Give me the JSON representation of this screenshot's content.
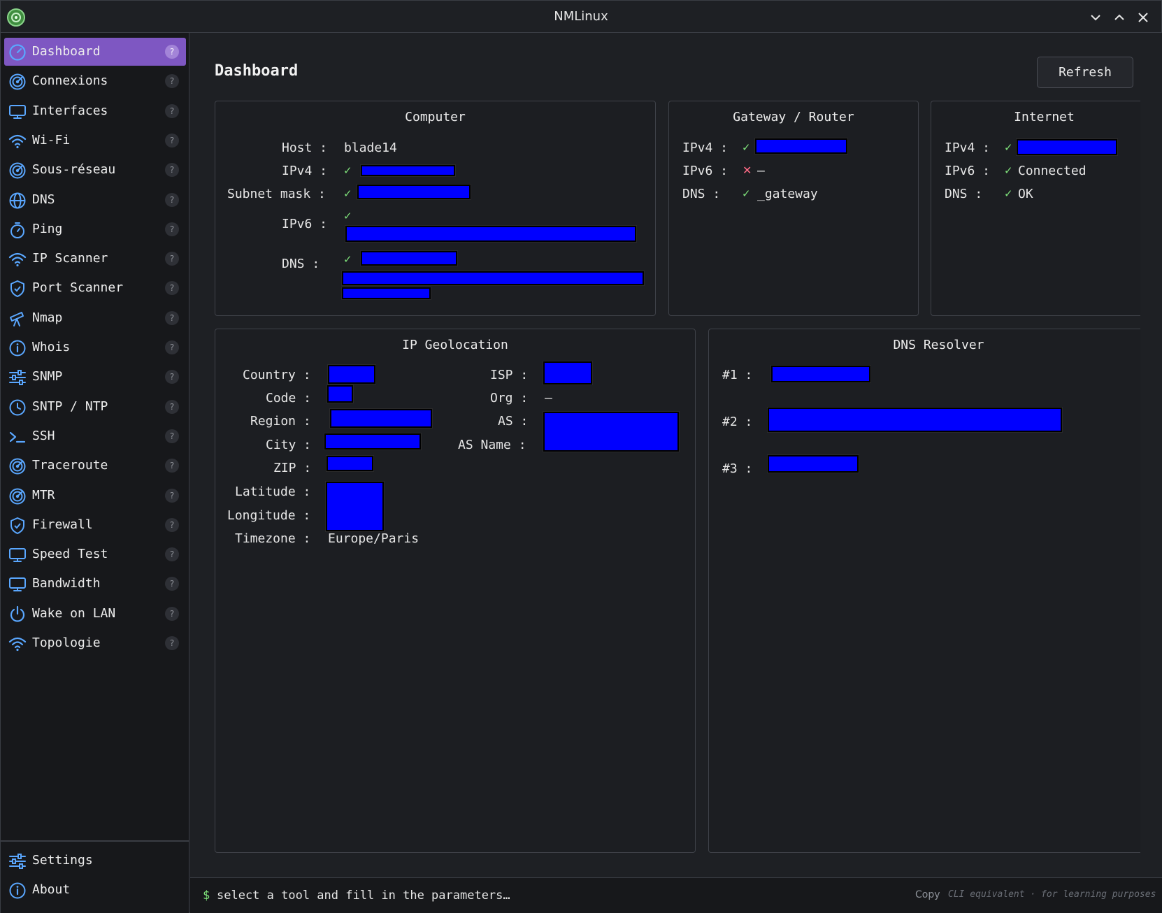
{
  "window": {
    "title": "NMLinux"
  },
  "sidebar": {
    "items": [
      {
        "label": "Dashboard",
        "icon": "gauge-icon",
        "help": "?"
      },
      {
        "label": "Connexions",
        "icon": "radar-icon",
        "help": "?"
      },
      {
        "label": "Interfaces",
        "icon": "monitor-icon",
        "help": "?"
      },
      {
        "label": "Wi-Fi",
        "icon": "wifi-icon",
        "help": "?"
      },
      {
        "label": "Sous-réseau",
        "icon": "radar-icon",
        "help": "?"
      },
      {
        "label": "DNS",
        "icon": "globe-icon",
        "help": "?"
      },
      {
        "label": "Ping",
        "icon": "stopwatch-icon",
        "help": "?"
      },
      {
        "label": "IP Scanner",
        "icon": "wifi-icon",
        "help": "?"
      },
      {
        "label": "Port Scanner",
        "icon": "shield-icon",
        "help": "?"
      },
      {
        "label": "Nmap",
        "icon": "telescope-icon",
        "help": "?"
      },
      {
        "label": "Whois",
        "icon": "info-icon",
        "help": "?"
      },
      {
        "label": "SNMP",
        "icon": "sliders-icon",
        "help": "?"
      },
      {
        "label": "SNTP / NTP",
        "icon": "clock-icon",
        "help": "?"
      },
      {
        "label": "SSH",
        "icon": "terminal-icon",
        "help": "?"
      },
      {
        "label": "Traceroute",
        "icon": "radar-icon",
        "help": "?"
      },
      {
        "label": "MTR",
        "icon": "radar-icon",
        "help": "?"
      },
      {
        "label": "Firewall",
        "icon": "shield-icon",
        "help": "?"
      },
      {
        "label": "Speed Test",
        "icon": "monitor-icon",
        "help": "?"
      },
      {
        "label": "Bandwidth",
        "icon": "monitor-icon",
        "help": "?"
      },
      {
        "label": "Wake on LAN",
        "icon": "power-icon",
        "help": "?"
      },
      {
        "label": "Topologie",
        "icon": "wifi-icon",
        "help": "?"
      }
    ],
    "bottom": [
      {
        "label": "Settings",
        "icon": "sliders-icon"
      },
      {
        "label": "About",
        "icon": "info-icon"
      }
    ]
  },
  "main": {
    "title": "Dashboard",
    "refresh_label": "Refresh",
    "computer": {
      "title": "Computer",
      "host_label": "Host :",
      "host_value": "blade14",
      "ipv4_label": "IPv4 :",
      "subnet_label": "Subnet mask :",
      "ipv6_label": "IPv6 :",
      "dns_label": "DNS  :"
    },
    "gateway": {
      "title": "Gateway / Router",
      "ipv4_label": "IPv4 :",
      "ipv6_label": "IPv6 :",
      "ipv6_value": "—",
      "dns_label": "DNS  :",
      "dns_value": "_gateway"
    },
    "internet": {
      "title": "Internet",
      "ipv4_label": "IPv4 :",
      "ipv6_label": "IPv6 :",
      "ipv6_value": "Connected",
      "dns_label": "DNS  :",
      "dns_value": "OK"
    },
    "geolocation": {
      "title": "IP Geolocation",
      "country_label": "Country :",
      "code_label": "Code :",
      "region_label": "Region :",
      "city_label": "City :",
      "zip_label": "ZIP :",
      "latitude_label": "Latitude :",
      "longitude_label": "Longitude :",
      "timezone_label": "Timezone :",
      "timezone_value": "Europe/Paris",
      "isp_label": "ISP :",
      "org_label": "Org :",
      "org_value": "—",
      "as_label": "AS :",
      "as_name_label": "AS Name :"
    },
    "dns_resolver": {
      "title": "DNS Resolver",
      "r1_label": "#1 :",
      "r2_label": "#2 :",
      "r3_label": "#3 :"
    },
    "status": {
      "ok_mark": "✓",
      "fail_mark": "✕"
    }
  },
  "cli": {
    "prompt": "$",
    "text": "select a tool and fill in the parameters…",
    "copy_label": "Copy",
    "hint": "CLI equivalent · for learning purposes"
  },
  "colors": {
    "accent": "#7e57c2",
    "ok": "#7ee07a",
    "fail": "#ff6b86",
    "redaction": "#0000ff"
  }
}
